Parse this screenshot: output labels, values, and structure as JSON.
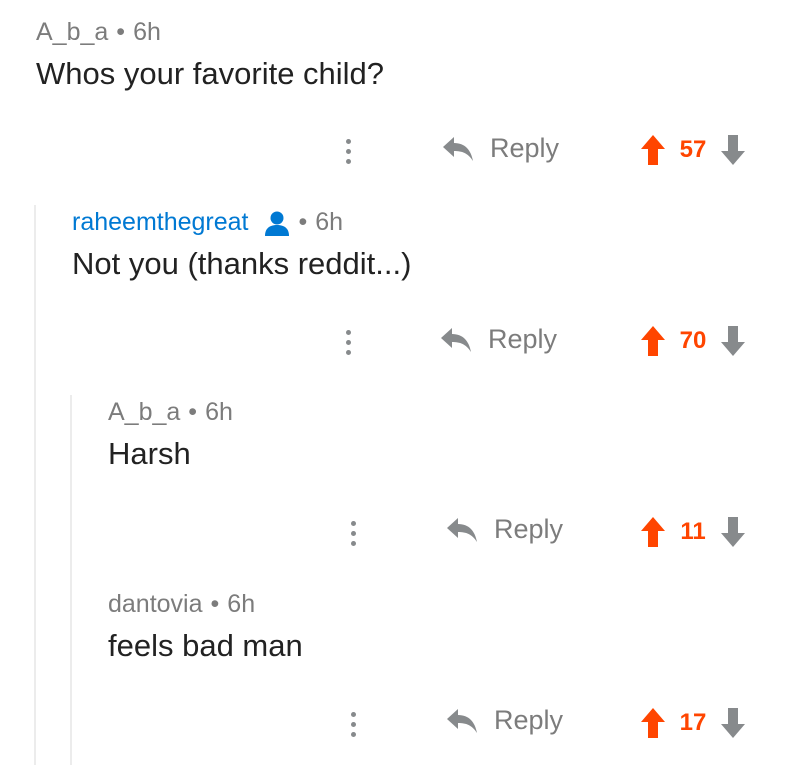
{
  "colors": {
    "upvote": "#ff4500",
    "downvote": "#878a8c",
    "op_author": "#0079d3",
    "meta_text": "#7c7c7c"
  },
  "comments": [
    {
      "author": "A_b_a",
      "separator": "•",
      "age": "6h",
      "body": "Whos your favorite child?",
      "reply_label": "Reply",
      "score": "57",
      "icons": [
        "more-vertical-icon",
        "reply-arrow-icon",
        "upvote-arrow-icon",
        "downvote-arrow-icon"
      ]
    },
    {
      "author": "raheemthegreat",
      "separator": "•",
      "age": "6h",
      "body": "Not you (thanks reddit...)",
      "reply_label": "Reply",
      "score": "70",
      "is_op": true,
      "icons": [
        "user-icon",
        "more-vertical-icon",
        "reply-arrow-icon",
        "upvote-arrow-icon",
        "downvote-arrow-icon"
      ]
    },
    {
      "author": "A_b_a",
      "separator": "•",
      "age": "6h",
      "body": "Harsh",
      "reply_label": "Reply",
      "score": "11",
      "icons": [
        "more-vertical-icon",
        "reply-arrow-icon",
        "upvote-arrow-icon",
        "downvote-arrow-icon"
      ]
    },
    {
      "author": "dantovia",
      "separator": "•",
      "age": "6h",
      "body": "feels bad man",
      "reply_label": "Reply",
      "score": "17",
      "icons": [
        "more-vertical-icon",
        "reply-arrow-icon",
        "upvote-arrow-icon",
        "downvote-arrow-icon"
      ]
    }
  ]
}
